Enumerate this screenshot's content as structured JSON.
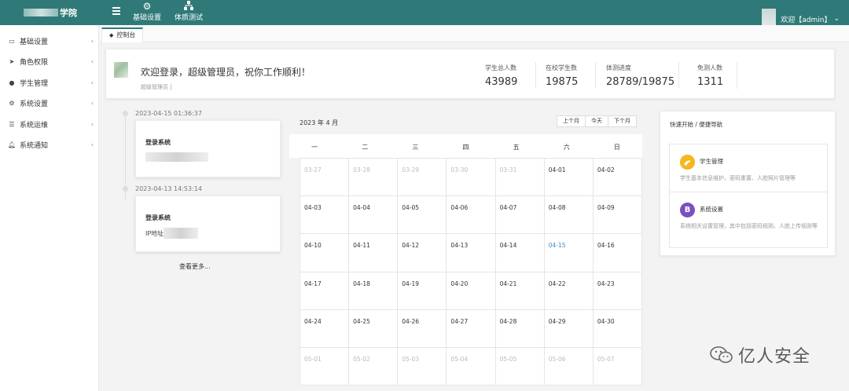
{
  "topbar": {
    "brand_suffix": "学院",
    "nav": [
      {
        "label": "基础设置",
        "icon": "gear-icon"
      },
      {
        "label": "体质测试",
        "icon": "sitemap-icon"
      }
    ],
    "user_greeting": "欢迎【admin】",
    "user_chevron": "⌄"
  },
  "sidebar": {
    "items": [
      {
        "label": "基础设置",
        "icon": "monitor-icon"
      },
      {
        "label": "角色权限",
        "icon": "send-icon"
      },
      {
        "label": "学生管理",
        "icon": "users-icon"
      },
      {
        "label": "系统设置",
        "icon": "gears-icon"
      },
      {
        "label": "系统运维",
        "icon": "list-icon"
      },
      {
        "label": "系统通知",
        "icon": "bell-icon"
      }
    ]
  },
  "tabs": [
    {
      "label": "控制台",
      "active": true
    }
  ],
  "welcome": {
    "title": "欢迎登录，超级管理员，祝你工作顺利！",
    "role": "超级管理员 |",
    "stats": [
      {
        "label": "学生总人数",
        "value": "43989"
      },
      {
        "label": "在校学生数",
        "value": "19875"
      },
      {
        "label": "体测进度",
        "value": "28789/19875"
      },
      {
        "label": "免测人数",
        "value": "1311"
      }
    ]
  },
  "timeline": {
    "entries": [
      {
        "time": "2023-04-15 01:36:37",
        "title": "登录系统",
        "detail": ""
      },
      {
        "time": "2023-04-13 14:53:14",
        "title": "登录系统",
        "detail": "IP地址"
      }
    ],
    "more": "查看更多..."
  },
  "calendar": {
    "title": "2023 年 4 月",
    "buttons": {
      "prev": "上个月",
      "today": "今天",
      "next": "下个月"
    },
    "weekdays": [
      "一",
      "二",
      "三",
      "四",
      "五",
      "六",
      "日"
    ],
    "weeks": [
      [
        "03-27",
        "03-28",
        "03-29",
        "03-30",
        "03-31",
        "04-01",
        "04-02"
      ],
      [
        "04-03",
        "04-04",
        "04-05",
        "04-06",
        "04-07",
        "04-08",
        "04-09"
      ],
      [
        "04-10",
        "04-11",
        "04-12",
        "04-13",
        "04-14",
        "04-15",
        "04-16"
      ],
      [
        "04-17",
        "04-18",
        "04-19",
        "04-20",
        "04-21",
        "04-22",
        "04-23"
      ],
      [
        "04-24",
        "04-25",
        "04-26",
        "04-27",
        "04-28",
        "04-29",
        "04-30"
      ],
      [
        "05-01",
        "05-02",
        "05-03",
        "05-04",
        "05-05",
        "05-06",
        "05-07"
      ]
    ],
    "today": "04-15"
  },
  "quick_nav": {
    "title": "快速开始 / 便捷导航",
    "items": [
      {
        "name": "学生管理",
        "desc": "学生基本信息维护、密码重置、人脸照片管理等",
        "icon": "student-icon",
        "color": "#f4b71f"
      },
      {
        "name": "系统设置",
        "desc": "系统相关设置管理，其中包括密码规则、人脸上传规则等",
        "icon_letter": "B",
        "color": "#7b4fbf"
      }
    ]
  },
  "watermark": {
    "text": "亿人安全"
  },
  "colors": {
    "topbar": "#2f7a78",
    "today": "#3c8dbc"
  }
}
